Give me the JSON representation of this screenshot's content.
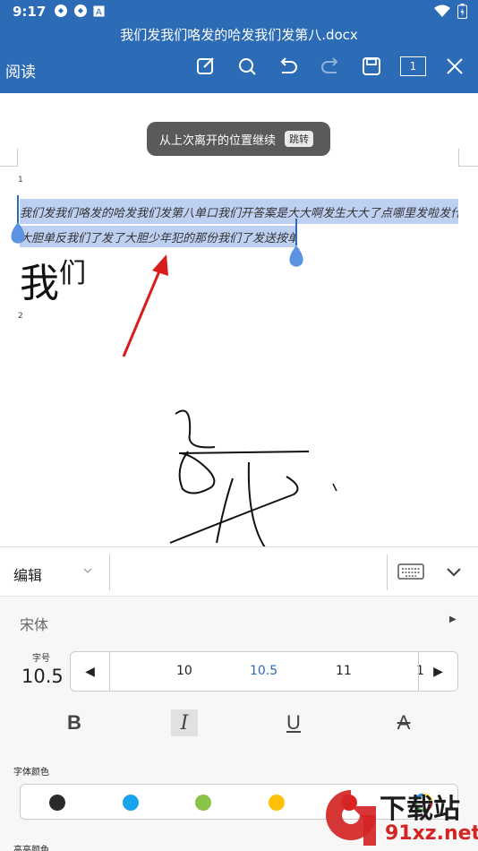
{
  "status_bar": {
    "time": "9:17"
  },
  "header": {
    "title": "我们发我们咯发的哈发我们发第八.docx",
    "mode": "阅读",
    "page_count": "1",
    "icons": [
      "edit-icon",
      "search-icon",
      "undo-icon",
      "redo-icon",
      "save-icon",
      "pages-icon",
      "close-icon"
    ]
  },
  "document": {
    "toast_text": "从上次离开的位置继续",
    "toast_button": "跳转",
    "page1_number": "1",
    "page2_number": "2",
    "line1": "我们发我们咯发的哈发我们发第八单口我们开答案是大大啊发生大大了点哪里发啦发什么",
    "line2": "大胆单反我们了发了大胆少年犯的那份我们了发送按单发",
    "big_text_main": "我",
    "big_text_small": "们"
  },
  "panel": {
    "edit_label": "编辑",
    "font_name": "宋体",
    "size_caption": "字号",
    "size_value": "10.5",
    "size_options": [
      "10",
      "10.5",
      "11",
      "1"
    ],
    "selected_size": "10.5",
    "style_buttons": {
      "bold": "B",
      "italic": "I",
      "underline": "U",
      "strike": "A"
    },
    "font_color_caption": "字体颜色",
    "font_colors": [
      "#2b2b2b",
      "#1aa3ea",
      "#8bc34a",
      "#ffc107",
      "#e02020"
    ],
    "highlight_caption": "高亮颜色"
  },
  "watermark": {
    "line1": "下载站",
    "line2": "91xz.net"
  }
}
